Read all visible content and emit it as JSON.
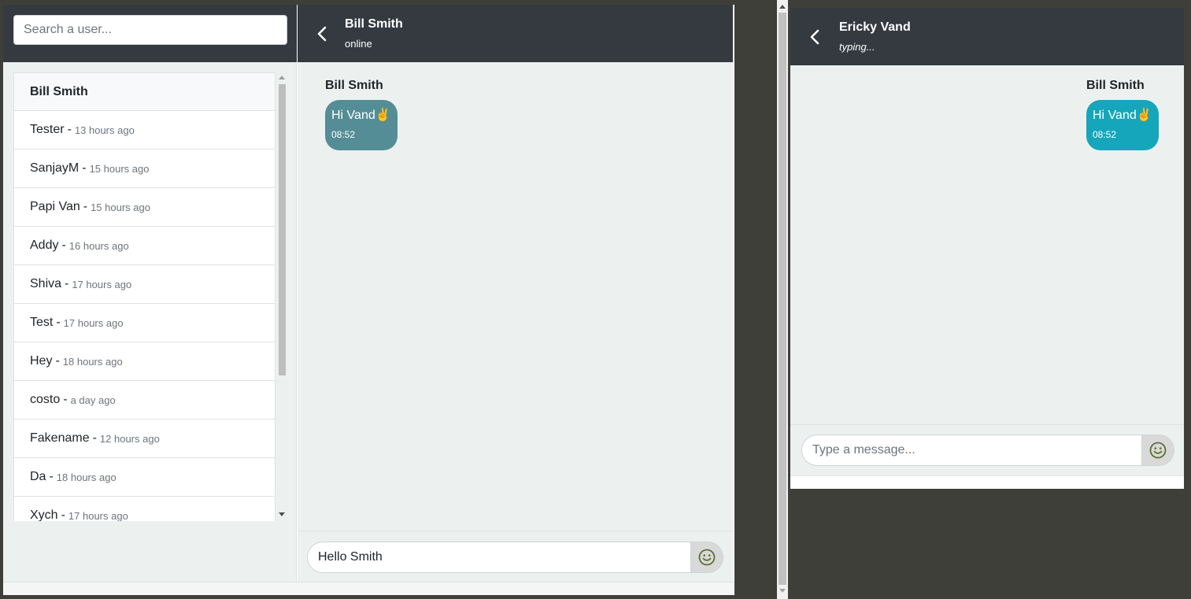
{
  "left_window": {
    "search": {
      "placeholder": "Search a user..."
    },
    "users": [
      {
        "name": "Bill Smith",
        "time": "",
        "active": true
      },
      {
        "name": "Tester",
        "time": "13 hours ago"
      },
      {
        "name": "SanjayM",
        "time": "15 hours ago"
      },
      {
        "name": "Papi Van",
        "time": "15 hours ago"
      },
      {
        "name": "Addy",
        "time": "16 hours ago"
      },
      {
        "name": "Shiva",
        "time": "17 hours ago"
      },
      {
        "name": "Test",
        "time": "17 hours ago"
      },
      {
        "name": "Hey",
        "time": "18 hours ago"
      },
      {
        "name": "costo",
        "time": "a day ago"
      },
      {
        "name": "Fakename",
        "time": "12 hours ago"
      },
      {
        "name": "Da",
        "time": "18 hours ago"
      },
      {
        "name": "Xych",
        "time": "17 hours ago"
      }
    ],
    "header": {
      "name": "Bill Smith",
      "status": "online"
    },
    "message": {
      "sender": "Bill Smith",
      "text": "Hi Vand✌️",
      "time": "08:52"
    },
    "composer": {
      "value": "Hello Smith",
      "placeholder": "Type a message..."
    }
  },
  "right_window": {
    "header": {
      "name": "Ericky Vand",
      "status": "typing..."
    },
    "message": {
      "sender": "Bill Smith",
      "text": "Hi Vand✌️",
      "time": "08:52"
    },
    "composer": {
      "value": "",
      "placeholder": "Type a message..."
    }
  },
  "colors": {
    "header_bg": "#343a40",
    "chat_bg": "#ecf1ef",
    "received_bubble": "#558d96",
    "sent_bubble": "#15a6bb",
    "emoji_icon": "#5c6f2e"
  }
}
